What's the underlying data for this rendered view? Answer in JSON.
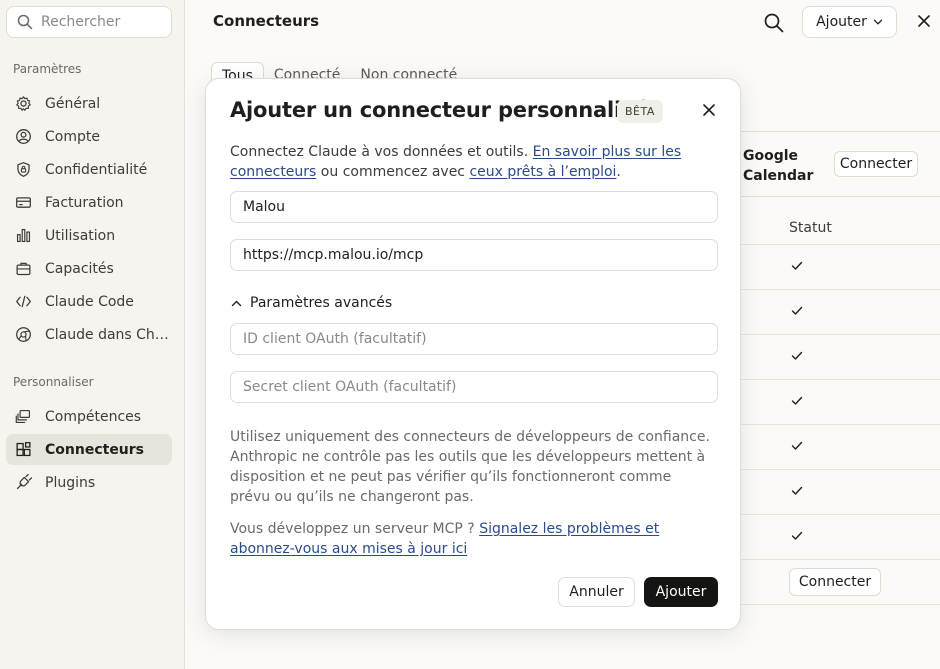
{
  "sidebar": {
    "search_placeholder": "Rechercher",
    "section_settings": "Paramètres",
    "section_personalize": "Personnaliser",
    "items": [
      {
        "label": "Général",
        "icon": "gear-icon"
      },
      {
        "label": "Compte",
        "icon": "user-circle-icon"
      },
      {
        "label": "Confidentialité",
        "icon": "shield-lock-icon"
      },
      {
        "label": "Facturation",
        "icon": "credit-card-icon"
      },
      {
        "label": "Utilisation",
        "icon": "bar-chart-icon"
      },
      {
        "label": "Capacités",
        "icon": "briefcase-icon"
      },
      {
        "label": "Claude Code",
        "icon": "code-icon"
      },
      {
        "label": "Claude dans Ch…",
        "icon": "globe-icon"
      },
      {
        "label": "Compétences",
        "icon": "layers-icon"
      },
      {
        "label": "Connecteurs",
        "icon": "connector-grid-icon",
        "active": true
      },
      {
        "label": "Plugins",
        "icon": "plug-icon"
      }
    ]
  },
  "header": {
    "title": "Connecteurs",
    "add_label": "Ajouter"
  },
  "tabs": [
    "Tous",
    "Connecté",
    "Non connecté"
  ],
  "google_calendar": {
    "name": "Google Calendar",
    "button": "Connecter"
  },
  "table": {
    "status_header": "Statut",
    "row_connect_label": "Connecter"
  },
  "modal": {
    "title": "Ajouter un connecteur personnalisé",
    "badge": "BÊTA",
    "desc_prefix": "Connectez Claude à vos données et outils. ",
    "desc_link1": "En savoir plus sur les connecteurs",
    "desc_middle": " ou commencez avec ",
    "desc_link2": "ceux prêts à l’emploi",
    "desc_suffix": ".",
    "name_value": "Malou",
    "url_value": "https://mcp.malou.io/mcp",
    "advanced_label": "Paramètres avancés",
    "client_id_placeholder": "ID client OAuth (facultatif)",
    "client_secret_placeholder": "Secret client OAuth (facultatif)",
    "warning": "Utilisez uniquement des connecteurs de développeurs de confiance. Anthropic ne contrôle pas les outils que les développeurs mettent à disposition et ne peut pas vérifier qu’ils fonctionneront comme prévu ou qu’ils ne changeront pas.",
    "mcp_prefix": "Vous développez un serveur MCP ? ",
    "mcp_link": "Signalez les problèmes et abonnez-vous aux mises à jour ici",
    "cancel_label": "Annuler",
    "add_label": "Ajouter"
  }
}
